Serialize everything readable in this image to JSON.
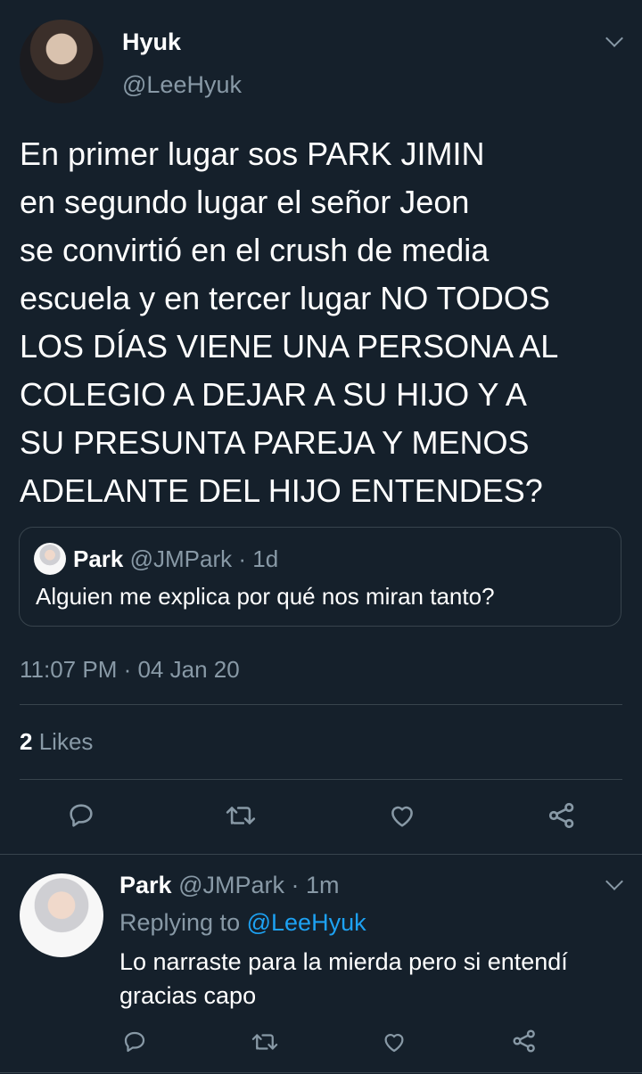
{
  "main_tweet": {
    "author_name": "Hyuk",
    "author_handle": "@LeeHyuk",
    "text": "En primer lugar sos PARK JIMIN\nen segundo lugar el señor Jeon\nse convirtió en el crush de media\nescuela y en tercer lugar NO TODOS\nLOS DÍAS VIENE UNA PERSONA AL\nCOLEGIO A DEJAR A SU HIJO Y A\nSU PRESUNTA PAREJA Y MENOS\nADELANTE DEL HIJO ENTENDES?",
    "quoted": {
      "author_name": "Park",
      "author_handle": "@JMPark",
      "time": "· 1d",
      "text": "Alguien me explica por qué nos miran tanto?"
    },
    "timestamp": "11:07 PM · 04 Jan 20",
    "likes_count": "2",
    "likes_label": "Likes"
  },
  "reply": {
    "author_name": "Park",
    "author_handle": "@JMPark",
    "time": "· 1m",
    "replying_to_prefix": "Replying to",
    "replying_to_handle": "@LeeHyuk",
    "text": "Lo narraste para la mierda pero si entendí\ngracias capo"
  },
  "icons": [
    "chevron-down-icon",
    "reply-icon",
    "retweet-icon",
    "like-icon",
    "share-icon"
  ],
  "colors": {
    "background": "#15202b",
    "text": "#ffffff",
    "muted": "#8899a6",
    "link": "#1da1f2",
    "border": "#38444d"
  }
}
